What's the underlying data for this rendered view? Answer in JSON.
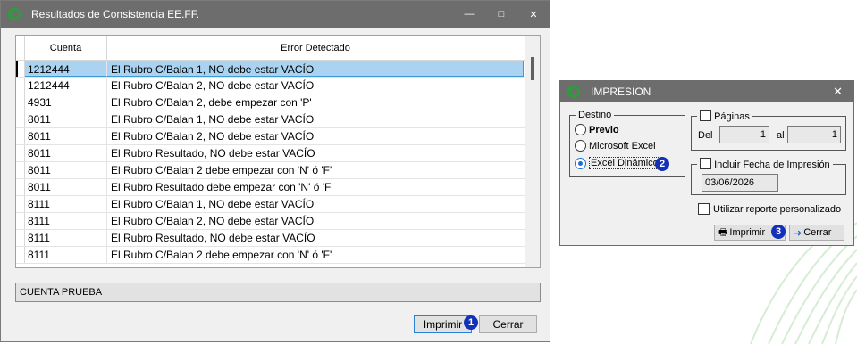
{
  "main_window": {
    "title": "Resultados de Consistencia EE.FF.",
    "minimize_glyph": "—",
    "maximize_glyph": "□",
    "close_glyph": "✕",
    "columns": [
      "Cuenta",
      "Error Detectado"
    ],
    "rows": [
      {
        "cuenta": "1212444",
        "error": "El Rubro C/Balan 1, NO debe estar VACÍO"
      },
      {
        "cuenta": "1212444",
        "error": "El Rubro C/Balan 2, NO debe estar VACÍO"
      },
      {
        "cuenta": "4931",
        "error": "El Rubro C/Balan 2, debe empezar con 'P'"
      },
      {
        "cuenta": "8011",
        "error": "El Rubro C/Balan 1, NO debe estar VACÍO"
      },
      {
        "cuenta": "8011",
        "error": "El Rubro C/Balan 2, NO debe estar VACÍO"
      },
      {
        "cuenta": "8011",
        "error": "El Rubro Resultado, NO debe estar VACÍO"
      },
      {
        "cuenta": "8011",
        "error": "El Rubro C/Balan 2 debe empezar con 'N' ó 'F'"
      },
      {
        "cuenta": "8011",
        "error": "El Rubro Resultado debe empezar con 'N' ó 'F'"
      },
      {
        "cuenta": "8111",
        "error": "El Rubro C/Balan 1, NO debe estar VACÍO"
      },
      {
        "cuenta": "8111",
        "error": "El Rubro C/Balan 2, NO debe estar VACÍO"
      },
      {
        "cuenta": "8111",
        "error": "El Rubro Resultado, NO debe estar VACÍO"
      },
      {
        "cuenta": "8111",
        "error": "El Rubro C/Balan 2 debe empezar con 'N' ó 'F'"
      }
    ],
    "selected_row": 0,
    "status_text": "CUENTA PRUEBA",
    "print_button": "Imprimir",
    "close_button": "Cerrar",
    "badge_1": "1"
  },
  "print_dialog": {
    "title": "IMPRESION",
    "close_glyph": "✕",
    "destino_legend": "Destino",
    "destino_options": [
      "Previo",
      "Microsoft Excel",
      "Excel Dinámico"
    ],
    "destino_selected": 2,
    "paginas_label": "Páginas",
    "del_label": "Del",
    "del_value": "1",
    "al_label": "al",
    "al_value": "1",
    "fecha_label": "Incluir Fecha de Impresión",
    "fecha_value": "03/06/2026",
    "personalizado_label": "Utilizar reporte personalizado",
    "imprimir_button": "Imprimir",
    "cerrar_button": "Cerrar",
    "badge_2": "2",
    "badge_3": "3"
  },
  "colors": {
    "titlebar": "#6d6d6d",
    "selection": "#a9d3f1",
    "badge": "#1230b8",
    "brand_green": "#2f9c3c"
  }
}
